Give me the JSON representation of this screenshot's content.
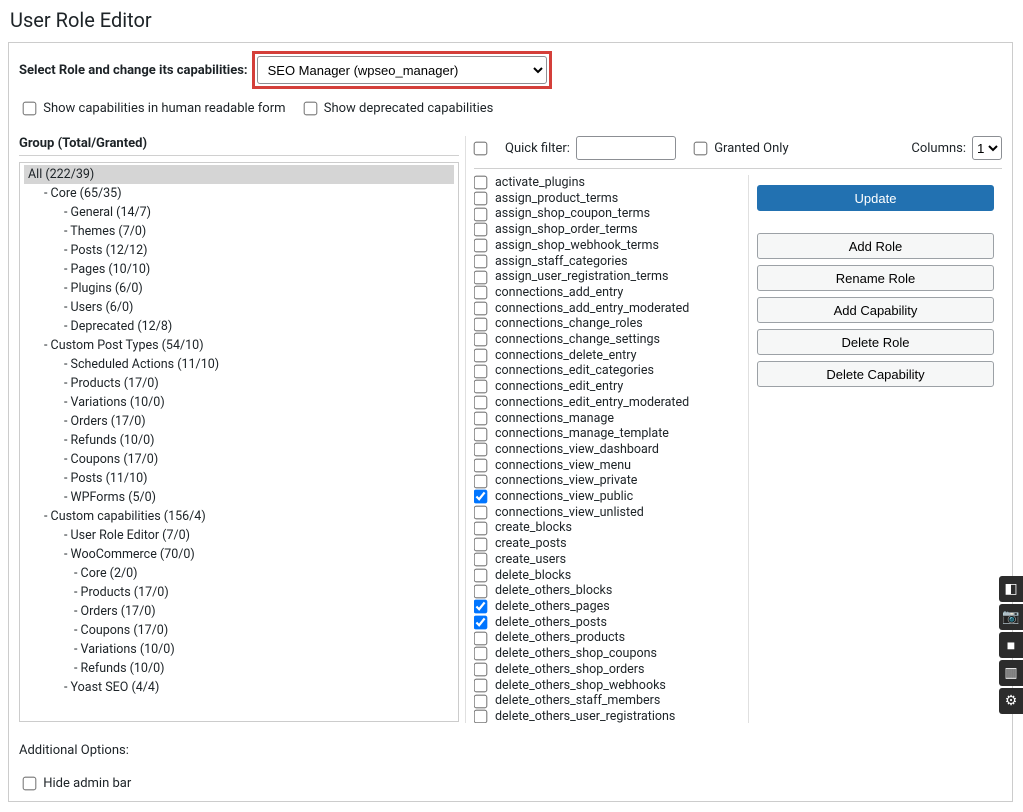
{
  "page_title": "User Role Editor",
  "select_label": "Select Role and change its capabilities:",
  "role_selected": "SEO Manager (wpseo_manager)",
  "show_human_readable": "Show capabilities in human readable form",
  "show_deprecated": "Show deprecated capabilities",
  "group_header": "Group (Total/Granted)",
  "quick_filter_label": "Quick filter:",
  "granted_only_label": "Granted Only",
  "columns_label": "Columns:",
  "columns_value": "1",
  "additional_options": "Additional Options:",
  "hide_admin_bar": "Hide admin bar",
  "actions": {
    "update": "Update",
    "add_role": "Add Role",
    "rename_role": "Rename Role",
    "add_capability": "Add Capability",
    "delete_role": "Delete Role",
    "delete_capability": "Delete Capability"
  },
  "tree": [
    {
      "label": "All (222/39)",
      "indent": 0,
      "selected": true,
      "dash": false
    },
    {
      "label": "Core (65/35)",
      "indent": 1,
      "dash": true
    },
    {
      "label": "General (14/7)",
      "indent": 2,
      "dash": true
    },
    {
      "label": "Themes (7/0)",
      "indent": 2,
      "dash": true
    },
    {
      "label": "Posts (12/12)",
      "indent": 2,
      "dash": true
    },
    {
      "label": "Pages (10/10)",
      "indent": 2,
      "dash": true
    },
    {
      "label": "Plugins (6/0)",
      "indent": 2,
      "dash": true
    },
    {
      "label": "Users (6/0)",
      "indent": 2,
      "dash": true
    },
    {
      "label": "Deprecated (12/8)",
      "indent": 2,
      "dash": true
    },
    {
      "label": "Custom Post Types (54/10)",
      "indent": 1,
      "dash": true
    },
    {
      "label": "Scheduled Actions (11/10)",
      "indent": 2,
      "dash": true
    },
    {
      "label": "Products (17/0)",
      "indent": 2,
      "dash": true
    },
    {
      "label": "Variations (10/0)",
      "indent": 2,
      "dash": true
    },
    {
      "label": "Orders (17/0)",
      "indent": 2,
      "dash": true
    },
    {
      "label": "Refunds (10/0)",
      "indent": 2,
      "dash": true
    },
    {
      "label": "Coupons (17/0)",
      "indent": 2,
      "dash": true
    },
    {
      "label": "Posts (11/10)",
      "indent": 2,
      "dash": true
    },
    {
      "label": "WPForms (5/0)",
      "indent": 2,
      "dash": true
    },
    {
      "label": "Custom capabilities (156/4)",
      "indent": 1,
      "dash": true
    },
    {
      "label": "User Role Editor (7/0)",
      "indent": 2,
      "dash": true
    },
    {
      "label": "WooCommerce (70/0)",
      "indent": 2,
      "dash": true
    },
    {
      "label": "Core (2/0)",
      "indent": 3,
      "dash": true
    },
    {
      "label": "Products (17/0)",
      "indent": 3,
      "dash": true
    },
    {
      "label": "Orders (17/0)",
      "indent": 3,
      "dash": true
    },
    {
      "label": "Coupons (17/0)",
      "indent": 3,
      "dash": true
    },
    {
      "label": "Variations (10/0)",
      "indent": 3,
      "dash": true
    },
    {
      "label": "Refunds (10/0)",
      "indent": 3,
      "dash": true
    },
    {
      "label": "Yoast SEO (4/4)",
      "indent": 2,
      "dash": true
    }
  ],
  "capabilities": [
    {
      "name": "activate_plugins",
      "checked": false
    },
    {
      "name": "assign_product_terms",
      "checked": false
    },
    {
      "name": "assign_shop_coupon_terms",
      "checked": false
    },
    {
      "name": "assign_shop_order_terms",
      "checked": false
    },
    {
      "name": "assign_shop_webhook_terms",
      "checked": false
    },
    {
      "name": "assign_staff_categories",
      "checked": false
    },
    {
      "name": "assign_user_registration_terms",
      "checked": false
    },
    {
      "name": "connections_add_entry",
      "checked": false
    },
    {
      "name": "connections_add_entry_moderated",
      "checked": false
    },
    {
      "name": "connections_change_roles",
      "checked": false
    },
    {
      "name": "connections_change_settings",
      "checked": false
    },
    {
      "name": "connections_delete_entry",
      "checked": false
    },
    {
      "name": "connections_edit_categories",
      "checked": false
    },
    {
      "name": "connections_edit_entry",
      "checked": false
    },
    {
      "name": "connections_edit_entry_moderated",
      "checked": false
    },
    {
      "name": "connections_manage",
      "checked": false
    },
    {
      "name": "connections_manage_template",
      "checked": false
    },
    {
      "name": "connections_view_dashboard",
      "checked": false
    },
    {
      "name": "connections_view_menu",
      "checked": false
    },
    {
      "name": "connections_view_private",
      "checked": false
    },
    {
      "name": "connections_view_public",
      "checked": true
    },
    {
      "name": "connections_view_unlisted",
      "checked": false
    },
    {
      "name": "create_blocks",
      "checked": false
    },
    {
      "name": "create_posts",
      "checked": false
    },
    {
      "name": "create_users",
      "checked": false
    },
    {
      "name": "delete_blocks",
      "checked": false
    },
    {
      "name": "delete_others_blocks",
      "checked": false
    },
    {
      "name": "delete_others_pages",
      "checked": true
    },
    {
      "name": "delete_others_posts",
      "checked": true
    },
    {
      "name": "delete_others_products",
      "checked": false
    },
    {
      "name": "delete_others_shop_coupons",
      "checked": false
    },
    {
      "name": "delete_others_shop_orders",
      "checked": false
    },
    {
      "name": "delete_others_shop_webhooks",
      "checked": false
    },
    {
      "name": "delete_others_staff_members",
      "checked": false
    },
    {
      "name": "delete_others_user_registrations",
      "checked": false
    }
  ]
}
